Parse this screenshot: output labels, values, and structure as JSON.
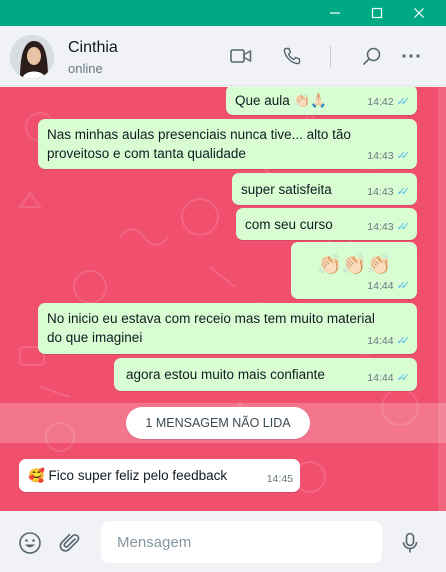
{
  "window": {
    "controls": [
      "minimize",
      "maximize",
      "close"
    ]
  },
  "header": {
    "contact_name": "Cinthia",
    "status": "online",
    "icons": [
      "video-call-icon",
      "voice-call-icon",
      "search-icon",
      "more-options-icon"
    ]
  },
  "messages": [
    {
      "direction": "outgoing",
      "text": "Que aula 👏🏻🙏🏻",
      "time": "14:42",
      "read": true
    },
    {
      "direction": "outgoing",
      "line1": "Nas minhas aulas presenciais nunca tive... alto tão",
      "line2": "proveitoso e com tanta qualidade",
      "time": "14:43",
      "read": true
    },
    {
      "direction": "outgoing",
      "text": "super satisfeita",
      "time": "14:43",
      "read": true
    },
    {
      "direction": "outgoing",
      "text": "com seu curso",
      "time": "14:43",
      "read": true
    },
    {
      "direction": "outgoing",
      "text": "👏🏻👏🏻👏🏻",
      "time": "14:44",
      "read": true
    },
    {
      "direction": "outgoing",
      "line1": "No inicio eu estava com receio mas tem muito material",
      "line2": "do que imaginei",
      "time": "14:44",
      "read": true
    },
    {
      "direction": "outgoing",
      "text": "agora estou muito mais confiante",
      "time": "14:44",
      "read": true
    },
    {
      "direction": "incoming",
      "text": "🥰 Fico super feliz pelo feedback",
      "time": "14:45"
    }
  ],
  "unread_label": "1 MENSAGEM NÃO LIDA",
  "composer": {
    "placeholder": "Mensagem",
    "icons": [
      "emoji-icon",
      "attach-icon",
      "microphone-icon"
    ]
  },
  "colors": {
    "titlebar": "#00a884",
    "chat_background": "#f0506e",
    "outgoing_bubble": "#d9fdd3",
    "incoming_bubble": "#ffffff",
    "read_ticks": "#53bdeb"
  }
}
